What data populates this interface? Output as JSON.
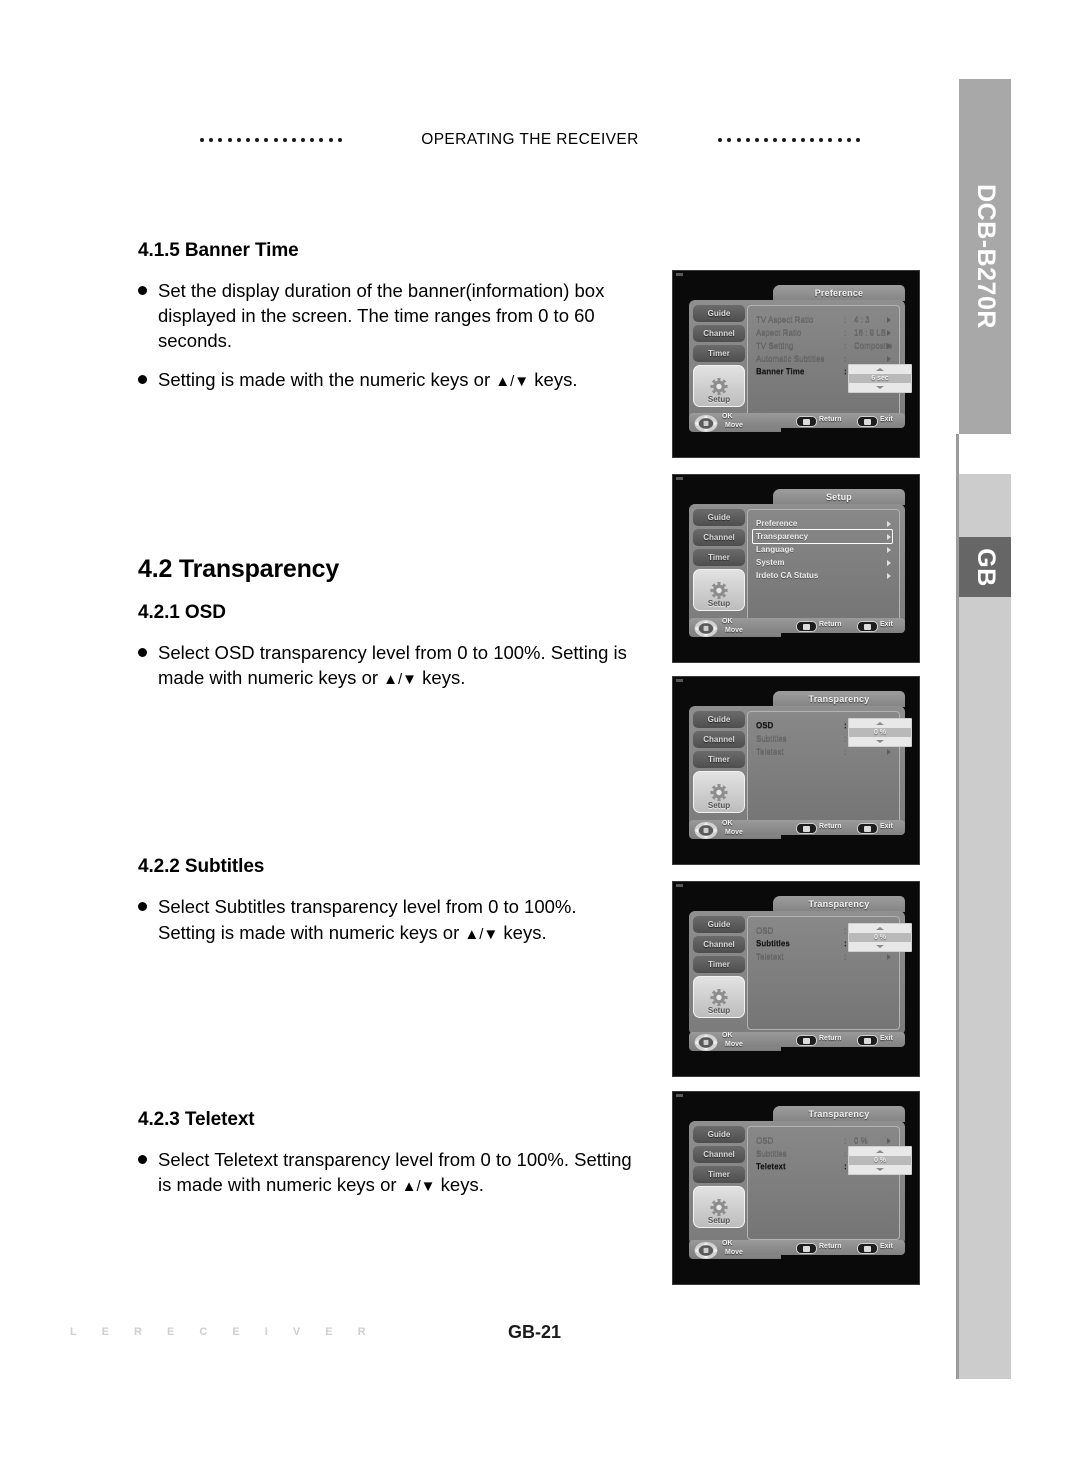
{
  "document": {
    "running_head": "OPERATING THE RECEIVER",
    "model": "DCB-B270R",
    "region_badge": "GB",
    "page_number": "GB-21",
    "footer_watermark": "LE RECEIVER"
  },
  "sections": [
    {
      "id": "banner-time",
      "heading": "4.1.5 Banner Time",
      "level": "h3",
      "bullets": [
        "Set the display duration of the banner(information) box displayed in the screen. The time ranges from 0 to 60 seconds.",
        "Setting is made with the numeric keys or ▲/▼ keys."
      ]
    },
    {
      "id": "transparency",
      "heading": "4.2 Transparency",
      "level": "h2",
      "bullets": []
    },
    {
      "id": "osd",
      "heading": "4.2.1 OSD",
      "level": "h3",
      "bullets": [
        "Select OSD transparency level from 0 to 100%. Setting is made with numeric keys or ▲/▼ keys."
      ]
    },
    {
      "id": "subtitles",
      "heading": "4.2.2 Subtitles",
      "level": "h3",
      "bullets": [
        "Select Subtitles transparency level from 0 to 100%. Setting is made with numeric keys or ▲/▼ keys."
      ]
    },
    {
      "id": "teletext",
      "heading": "4.2.3 Teletext",
      "level": "h3",
      "bullets": [
        "Select Teletext transparency level from 0 to 100%. Setting is made with numeric keys or ▲/▼ keys."
      ]
    }
  ],
  "osd_common": {
    "tabs": [
      "Guide",
      "Channel",
      "Timer"
    ],
    "setup_tab": "Setup",
    "help": {
      "ok": "OK",
      "move": "Move",
      "return": "Return",
      "exit": "Exit"
    }
  },
  "screenshots": [
    {
      "id": "preference-menu",
      "title": "Preference",
      "rows": [
        {
          "label": "TV Aspect Ratio",
          "value": "4 : 3",
          "selected": false,
          "spinner": null
        },
        {
          "label": "Aspect Ratio",
          "value": "16 : 9 LB",
          "selected": false,
          "spinner": null
        },
        {
          "label": "TV Setting",
          "value": "Composite",
          "selected": false,
          "spinner": null
        },
        {
          "label": "Automatic Subtitles",
          "value": "",
          "selected": false,
          "spinner": null
        },
        {
          "label": "Banner Time",
          "value": "",
          "selected": true,
          "spinner": "6 sec"
        }
      ],
      "spinner_row": 4
    },
    {
      "id": "setup-menu",
      "title": "Setup",
      "list_style": true,
      "rows": [
        {
          "label": "Preference",
          "value": "",
          "selected": false,
          "spinner": null
        },
        {
          "label": "Transparency",
          "value": "",
          "selected": true,
          "spinner": null
        },
        {
          "label": "Language",
          "value": "",
          "selected": false,
          "spinner": null
        },
        {
          "label": "System",
          "value": "",
          "selected": false,
          "spinner": null
        },
        {
          "label": "Irdeto CA Status",
          "value": "",
          "selected": false,
          "spinner": null
        }
      ],
      "spinner_row": -1
    },
    {
      "id": "transparency-osd",
      "title": "Transparency",
      "rows": [
        {
          "label": "OSD",
          "value": "",
          "selected": true,
          "spinner": "0 %"
        },
        {
          "label": "Subtitles",
          "value": "",
          "selected": false,
          "spinner": null
        },
        {
          "label": "Teletext",
          "value": "",
          "selected": false,
          "spinner": null
        }
      ],
      "spinner_row": 0
    },
    {
      "id": "transparency-subtitles",
      "title": "Transparency",
      "rows": [
        {
          "label": "OSD",
          "value": "",
          "selected": false,
          "spinner": null
        },
        {
          "label": "Subtitles",
          "value": "",
          "selected": true,
          "spinner": "0 %"
        },
        {
          "label": "Teletext",
          "value": "",
          "selected": false,
          "spinner": null
        }
      ],
      "spinner_row": 0
    },
    {
      "id": "transparency-teletext",
      "title": "Transparency",
      "rows": [
        {
          "label": "OSD",
          "value": "0 %",
          "selected": false,
          "spinner": null
        },
        {
          "label": "Subtitles",
          "value": "",
          "selected": false,
          "spinner": null
        },
        {
          "label": "Teletext",
          "value": "",
          "selected": true,
          "spinner": "0 %"
        }
      ],
      "spinner_row": 1
    }
  ],
  "colors": {
    "sidebar_dark": "#a8a8a8",
    "sidebar_light": "#cccccc",
    "badge": "#666666",
    "text": "#000000"
  }
}
